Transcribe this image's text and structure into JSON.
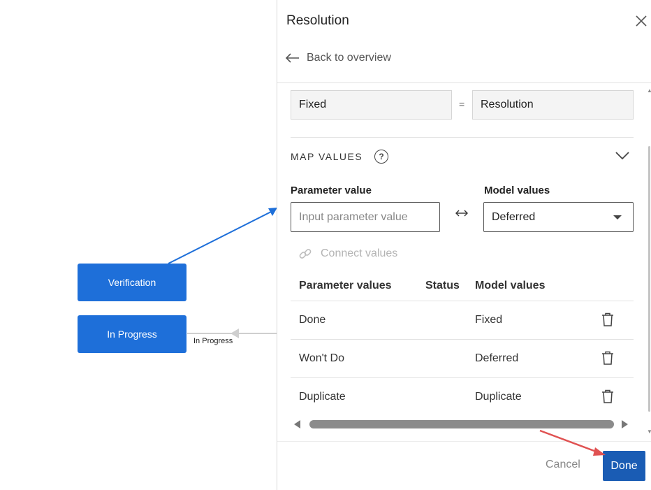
{
  "canvas": {
    "nodes": [
      {
        "label": "Verification"
      },
      {
        "label": "In Progress"
      }
    ],
    "edge_label": "In Progress"
  },
  "panel": {
    "title": "Resolution",
    "back_label": "Back to overview",
    "mapping": {
      "left_field": "Fixed",
      "operator": "=",
      "right_field": "Resolution"
    },
    "map_values": {
      "section_title": "MAP VALUES",
      "help_icon": "?",
      "parameter_value_label": "Parameter value",
      "parameter_value_placeholder": "Input parameter value",
      "model_values_label": "Model values",
      "model_values_selected": "Deferred",
      "connect_label": "Connect values",
      "table": {
        "headers": [
          "Parameter values",
          "Status",
          "Model values"
        ],
        "rows": [
          {
            "parameter": "Done",
            "status": "",
            "model": "Fixed"
          },
          {
            "parameter": "Won't Do",
            "status": "",
            "model": "Deferred"
          },
          {
            "parameter": "Duplicate",
            "status": "",
            "model": "Duplicate"
          }
        ]
      }
    },
    "footer": {
      "cancel_label": "Cancel",
      "done_label": "Done"
    }
  },
  "colors": {
    "node_blue": "#1e6fd9",
    "done_button": "#1a5cb4",
    "annotation_arrow": "#e05252"
  }
}
